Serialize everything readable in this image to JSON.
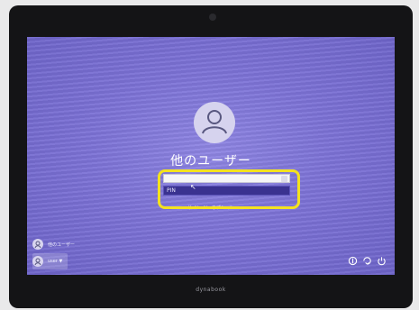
{
  "login": {
    "username": "他のユーザー",
    "password_field_text": "",
    "pin_field_text": "PIN",
    "forgot_link": "サインイン オプション",
    "cursor_glyph": "↖"
  },
  "users": [
    {
      "label": "他のユーザー"
    },
    {
      "label": "user ▼"
    }
  ],
  "system_icons": [
    "accessibility-icon",
    "network-icon",
    "power-icon"
  ],
  "device": {
    "brand": "dynabook"
  },
  "colors": {
    "wallpaper": "#7d73d7",
    "highlight": "#f4e21e"
  }
}
